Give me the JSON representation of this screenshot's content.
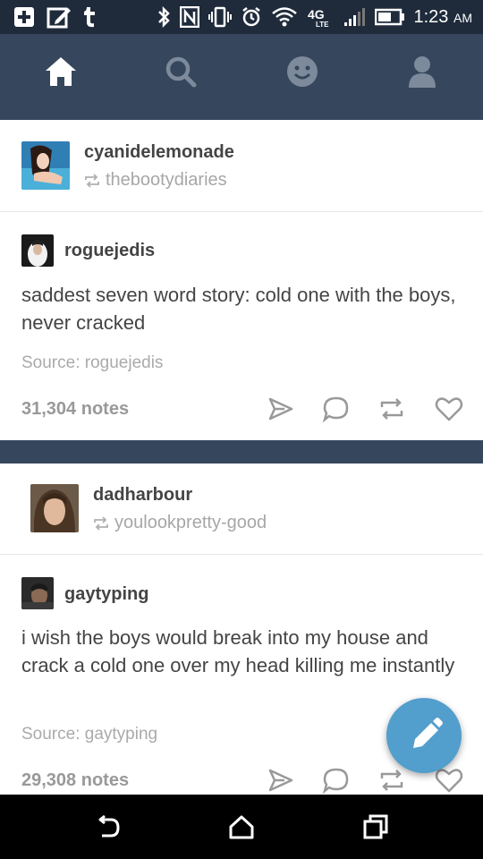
{
  "status_bar": {
    "time": "1:23",
    "ampm": "AM",
    "network": "4G LTE"
  },
  "nav": {
    "items": [
      "home-icon",
      "search-icon",
      "activity-icon",
      "account-icon"
    ],
    "active_color": "#ffffff",
    "inactive_color": "#7d8a9c"
  },
  "posts": [
    {
      "reblogger": "cyanidelemonade",
      "reblogged_from": "thebootydiaries",
      "author": "roguejedis",
      "body": "saddest seven word story: cold one with the boys, never cracked",
      "source": "Source: roguejedis",
      "notes": "31,304 notes"
    },
    {
      "reblogger": "dadharbour",
      "reblogged_from": "youlookpretty-good",
      "author": "gaytyping",
      "body": "i wish the boys would break into my house and crack a cold one over my head killing me instantly",
      "source": "Source: gaytyping",
      "notes": "29,308 notes"
    }
  ],
  "colors": {
    "dashboard_bg": "#36465d",
    "status_bar_bg": "#1f2b3b",
    "fab": "#529ecc"
  }
}
